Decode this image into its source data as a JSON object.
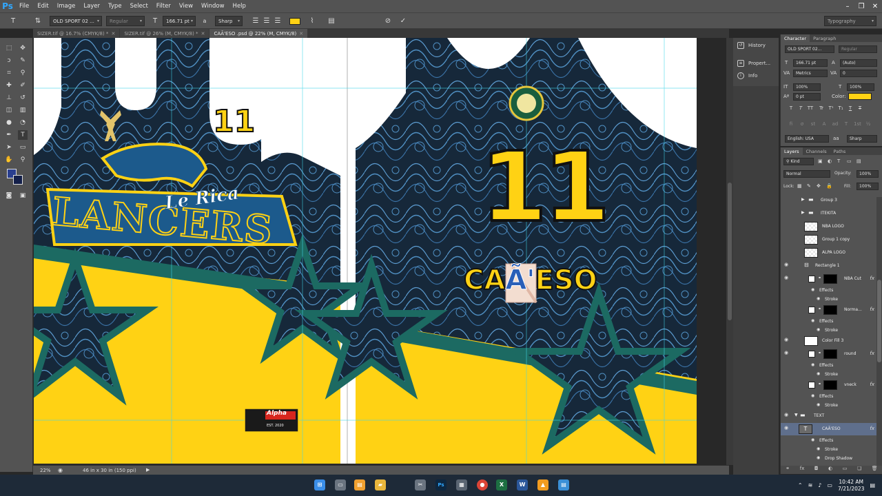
{
  "app": {
    "logo": "Ps",
    "menu": [
      "File",
      "Edit",
      "Image",
      "Layer",
      "Type",
      "Select",
      "Filter",
      "View",
      "Window",
      "Help"
    ],
    "window_controls": [
      "–",
      "❐",
      "✕"
    ]
  },
  "options_bar": {
    "font_family": "OLD SPORT 02 ...",
    "font_style": "Regular",
    "font_size": "166.71 pt",
    "antialias": "Sharp",
    "text_color": "#ffd214",
    "workspace": "Typography"
  },
  "tabs": [
    {
      "label": "SIZER.tif @ 16.7% (CMYK/8) *",
      "active": false
    },
    {
      "label": "SIZER.tif @ 26% (M, CMYK/8) *",
      "active": false
    },
    {
      "label": "CAÃ'ESO .psd @ 22% (M, CMYK/8)",
      "active": true
    }
  ],
  "artwork": {
    "front_number": "11",
    "back_number": "11",
    "team_word": "LANCERS",
    "team_script": "Le Rica",
    "player_name_left": "CA",
    "player_name_highlight": "Ã'",
    "player_name_right": "ESO",
    "sponsor_name": "Alpha",
    "sponsor_tag": "EST. 2020",
    "accent_yellow": "#ffd214",
    "accent_teal": "#1c6a62",
    "navy": "#16283a",
    "swirl_blue": "#4f8fc2"
  },
  "status": {
    "zoom": "22%",
    "doc_size": "46 in x 30 in (150 ppi)"
  },
  "panel_strip": [
    "History",
    "Propert...",
    "Info"
  ],
  "character": {
    "tabs": [
      "Character",
      "Paragraph"
    ],
    "font_family": "OLD SPORT 02...",
    "font_style": "Regular",
    "size": "166.71 pt",
    "leading": "(Auto)",
    "kerning": "Metrics",
    "tracking": "0",
    "vscale": "100%",
    "hscale": "100%",
    "baseline": "0 pt",
    "color_label": "Color:",
    "color_value": "#ffd214",
    "language": "English: USA",
    "antialias": "Sharp"
  },
  "layers": {
    "tabs": [
      "Layers",
      "Channels",
      "Paths"
    ],
    "filter": "Kind",
    "blend": "Normal",
    "opacity_label": "Opacity:",
    "opacity": "100%",
    "lock_label": "Lock:",
    "fill_label": "Fill:",
    "fill": "100%",
    "rows": [
      {
        "name": "Group 3",
        "kind": "group",
        "visible": false
      },
      {
        "name": "ITEKITA",
        "kind": "group",
        "visible": false
      },
      {
        "name": "NBA LOGO",
        "kind": "smart",
        "visible": false
      },
      {
        "name": "Group 1 copy",
        "kind": "smart",
        "visible": false
      },
      {
        "name": "ALPA LOGO",
        "kind": "smart",
        "visible": false
      },
      {
        "name": "Rectangle 1",
        "kind": "shape",
        "visible": true
      },
      {
        "name": "NBA Cut",
        "kind": "masked",
        "visible": true,
        "fx": true
      },
      {
        "name": "Effects",
        "kind": "effect"
      },
      {
        "name": "Stroke",
        "kind": "effect2"
      },
      {
        "name": "Norma...",
        "kind": "masked",
        "visible": false,
        "fx": true
      },
      {
        "name": "Effects",
        "kind": "effect"
      },
      {
        "name": "Stroke",
        "kind": "effect2"
      },
      {
        "name": "Color Fill 3",
        "kind": "fill",
        "visible": true
      },
      {
        "name": "round",
        "kind": "masked",
        "visible": true,
        "fx": true
      },
      {
        "name": "Effects",
        "kind": "effect"
      },
      {
        "name": "Stroke",
        "kind": "effect2"
      },
      {
        "name": "vneck",
        "kind": "masked",
        "visible": false,
        "fx": true
      },
      {
        "name": "Effects",
        "kind": "effect"
      },
      {
        "name": "Stroke",
        "kind": "effect2"
      },
      {
        "name": "TEXT",
        "kind": "folder",
        "visible": true
      },
      {
        "name": "CAÃ'ESO",
        "kind": "text",
        "visible": true,
        "fx": true,
        "selected": true
      },
      {
        "name": "Effects",
        "kind": "effect"
      },
      {
        "name": "Stroke",
        "kind": "effect2"
      },
      {
        "name": "Drop Shadow",
        "kind": "effect2"
      }
    ],
    "footer_icons": [
      "link-icon",
      "fx-icon",
      "mask-icon",
      "adjustment-icon",
      "folder-icon",
      "new-layer-icon",
      "trash-icon"
    ]
  },
  "taskbar": {
    "apps": [
      "start",
      "task-view",
      "file-explorer",
      "folder",
      "snipping",
      "photoshop",
      "calculator",
      "chrome",
      "excel",
      "word",
      "vlc",
      "notepad"
    ],
    "time": "10:42 AM",
    "date": "7/21/2023"
  }
}
